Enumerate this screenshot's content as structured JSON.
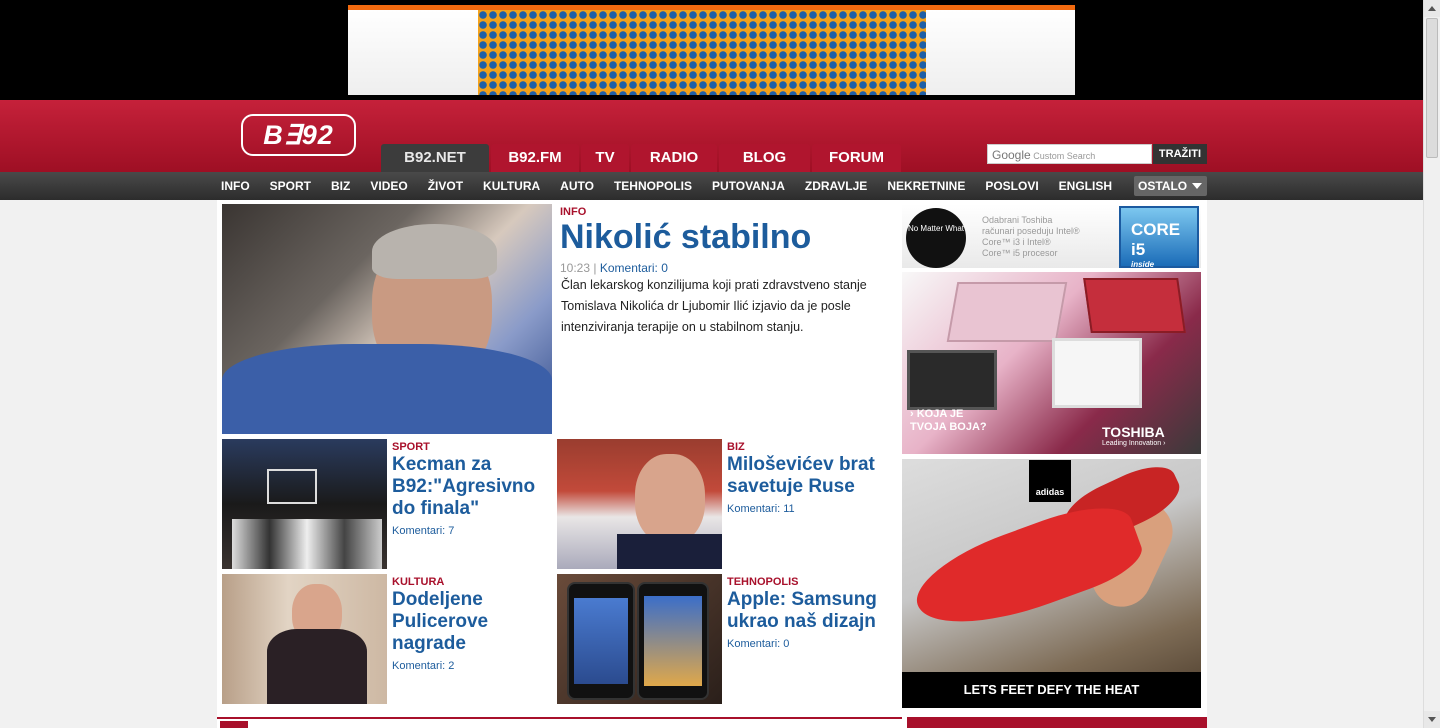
{
  "header": {
    "logo": "B∃92",
    "tabs": [
      {
        "label": "B92.NET",
        "active": true
      },
      {
        "label": "B92.FM"
      },
      {
        "label": "TV"
      },
      {
        "label": "RADIO"
      },
      {
        "label": "BLOG"
      },
      {
        "label": "FORUM"
      }
    ],
    "search_google": "Google",
    "search_placeholder": "Custom Search",
    "search_button": "TRAŽITI"
  },
  "nav": {
    "items": [
      "INFO",
      "SPORT",
      "BIZ",
      "VIDEO",
      "ŽIVOT",
      "KULTURA",
      "AUTO",
      "TEHNOPOLIS",
      "PUTOVANJA",
      "ZDRAVLJE",
      "NEKRETNINE",
      "POSLOVI",
      "ENGLISH"
    ],
    "more": "OSTALO"
  },
  "lead": {
    "category": "INFO",
    "title": "Nikolić stabilno",
    "time": "10:23",
    "separator": "|",
    "comments": "Komentari: 0",
    "summary": "Član lekarskog konzilijuma koji prati zdravstveno stanje Tomislava Nikolića dr Ljubomir Ilić izjavio da je posle intenziviranja terapije on u stabilnom stanju."
  },
  "stories": [
    {
      "category": "SPORT",
      "title": "Kecman za B92:\"Agresivno do finala\"",
      "comments": "Komentari: 7"
    },
    {
      "category": "BIZ",
      "title": "Miloševićev brat savetuje Ruse",
      "comments": "Komentari: 11"
    },
    {
      "category": "KULTURA",
      "title": "Dodeljene Pulicerove nagrade",
      "comments": "Komentari: 2"
    },
    {
      "category": "TEHNOPOLIS",
      "title": "Apple: Samsung ukrao naš dizajn",
      "comments": "Komentari: 0"
    }
  ],
  "ads": {
    "toshiba_small": {
      "badge": "No Matter What",
      "line1": "Odabrani Toshiba",
      "line2": "računari poseduju Intel®",
      "line3": "Core™ i3 i Intel®",
      "line4": "Core™ i5 procesor",
      "intel": "CORE i5",
      "intel_sub": "inside"
    },
    "toshiba_big": {
      "slogan_1": "› KOJA JE",
      "slogan_2": "TVOJA BOJA?",
      "brand": "TOSHIBA",
      "brand_sub": "Leading Innovation ›"
    },
    "adidas": {
      "brand": "adidas",
      "footer": "LETS FEET DEFY THE HEAT"
    }
  },
  "colors": {
    "brand_red": "#a8102b",
    "link_blue": "#1d5c9c",
    "nav_dark": "#2c2c2c"
  }
}
